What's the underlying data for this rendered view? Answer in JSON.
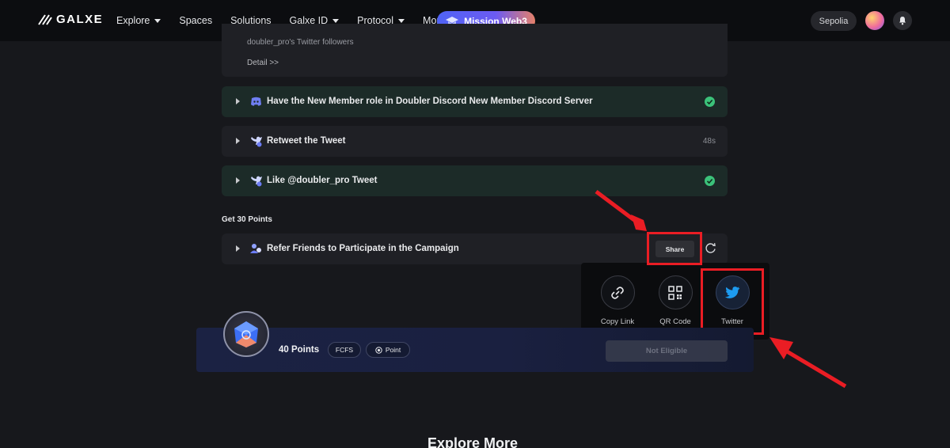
{
  "nav": {
    "brand": "GALXE",
    "items": [
      {
        "label": "Explore",
        "dropdown": true
      },
      {
        "label": "Spaces",
        "dropdown": false
      },
      {
        "label": "Solutions",
        "dropdown": false
      },
      {
        "label": "Galxe ID",
        "dropdown": true
      },
      {
        "label": "Protocol",
        "dropdown": true
      },
      {
        "label": "More",
        "dropdown": true
      }
    ],
    "mission_button": "Mission Web3",
    "network": "Sepolia"
  },
  "top_card": {
    "followers_text": "doubler_pro's Twitter followers",
    "detail_link": "Detail >>"
  },
  "tasks": [
    {
      "label": "Have the New Member role in Doubler Discord New Member Discord Server",
      "icon": "discord-icon",
      "status": "completed"
    },
    {
      "label": "Retweet the Tweet",
      "icon": "twitter-bird-icon",
      "status": "timer",
      "timer": "48s"
    },
    {
      "label": "Like @doubler_pro Tweet",
      "icon": "twitter-bird-icon",
      "status": "completed"
    }
  ],
  "points_section": {
    "title": "Get 30 Points",
    "task": {
      "label": "Refer Friends to Participate in the Campaign",
      "icon": "referral-icon"
    },
    "share_button": "Share"
  },
  "share_popup": {
    "options": [
      {
        "label": "Copy Link",
        "icon": "link-icon"
      },
      {
        "label": "QR Code",
        "icon": "qr-code-icon"
      },
      {
        "label": "Twitter",
        "icon": "twitter-icon"
      }
    ]
  },
  "reward": {
    "points": "40 Points",
    "tags": [
      "FCFS",
      "Point"
    ],
    "action": "Not Eligible"
  },
  "footer": {
    "explore_more": "Explore More"
  },
  "colors": {
    "highlight": "#ea1d24",
    "success": "#3bc27a",
    "twitter": "#1d9bf0"
  }
}
